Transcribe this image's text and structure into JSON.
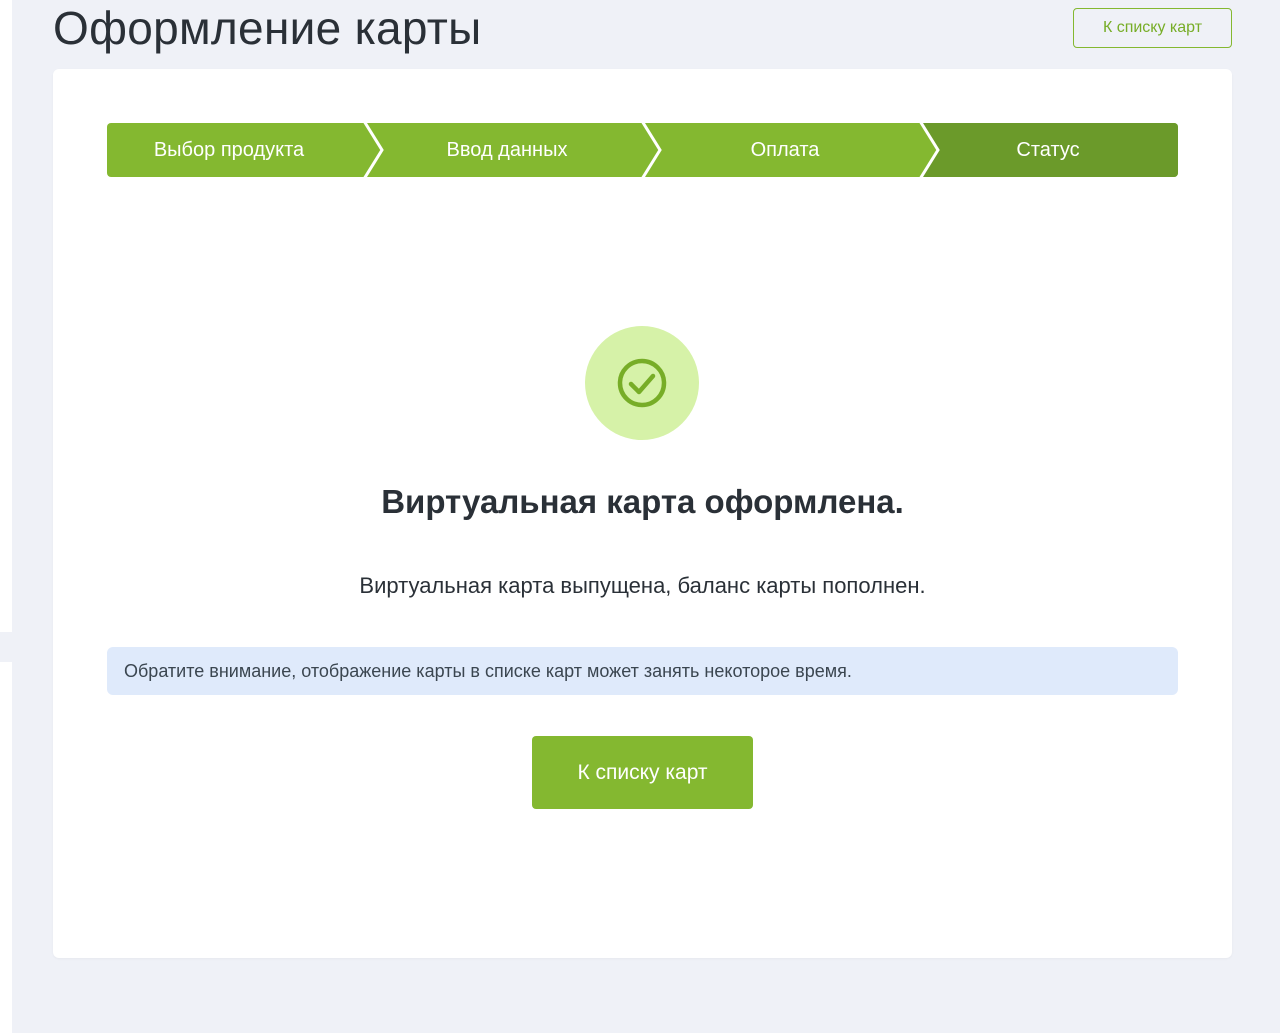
{
  "header": {
    "title": "Оформление карты",
    "back_button_label": "К списку карт"
  },
  "steps": [
    {
      "label": "Выбор продукта",
      "state": "completed"
    },
    {
      "label": "Ввод данных",
      "state": "completed"
    },
    {
      "label": "Оплата",
      "state": "completed"
    },
    {
      "label": "Статус",
      "state": "active"
    }
  ],
  "status": {
    "icon": "check-circle-icon",
    "title": "Виртуальная карта оформлена.",
    "message": "Виртуальная карта выпущена, баланс карты пополнен.",
    "notice": "Обратите внимание, отображение карты в списке карт может занять некоторое время.",
    "button_label": "К списку карт"
  },
  "colors": {
    "step_completed": "#84b830",
    "step_active": "#6b9a2a",
    "accent": "#84b830",
    "success_circle": "#d6f2a8",
    "notice_background": "#dfeafb",
    "page_background": "#eff1f7"
  }
}
